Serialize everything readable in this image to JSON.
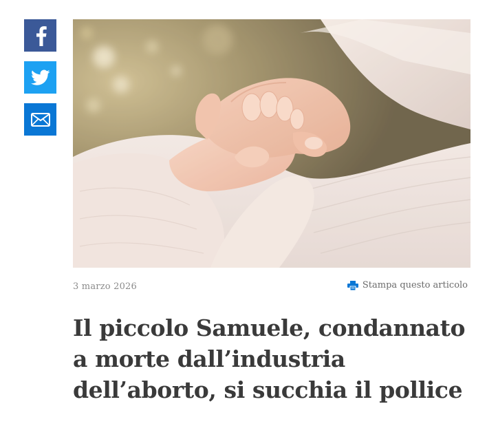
{
  "share": {
    "facebook_icon": "facebook-icon",
    "twitter_icon": "twitter-icon",
    "email_icon": "email-icon",
    "colors": {
      "facebook": "#3b5998",
      "twitter": "#1da1f2",
      "email": "#0a77d5"
    }
  },
  "article": {
    "image_alt": "Mano di un neonato stretta dalla mano di un adulto",
    "date": "3 marzo 2026",
    "print_label": "Stampa questo articolo",
    "print_icon": "printer-icon",
    "title": "Il piccolo Samuele, condannato a morte dall’industria dell’aborto, si succhia il pollice"
  }
}
